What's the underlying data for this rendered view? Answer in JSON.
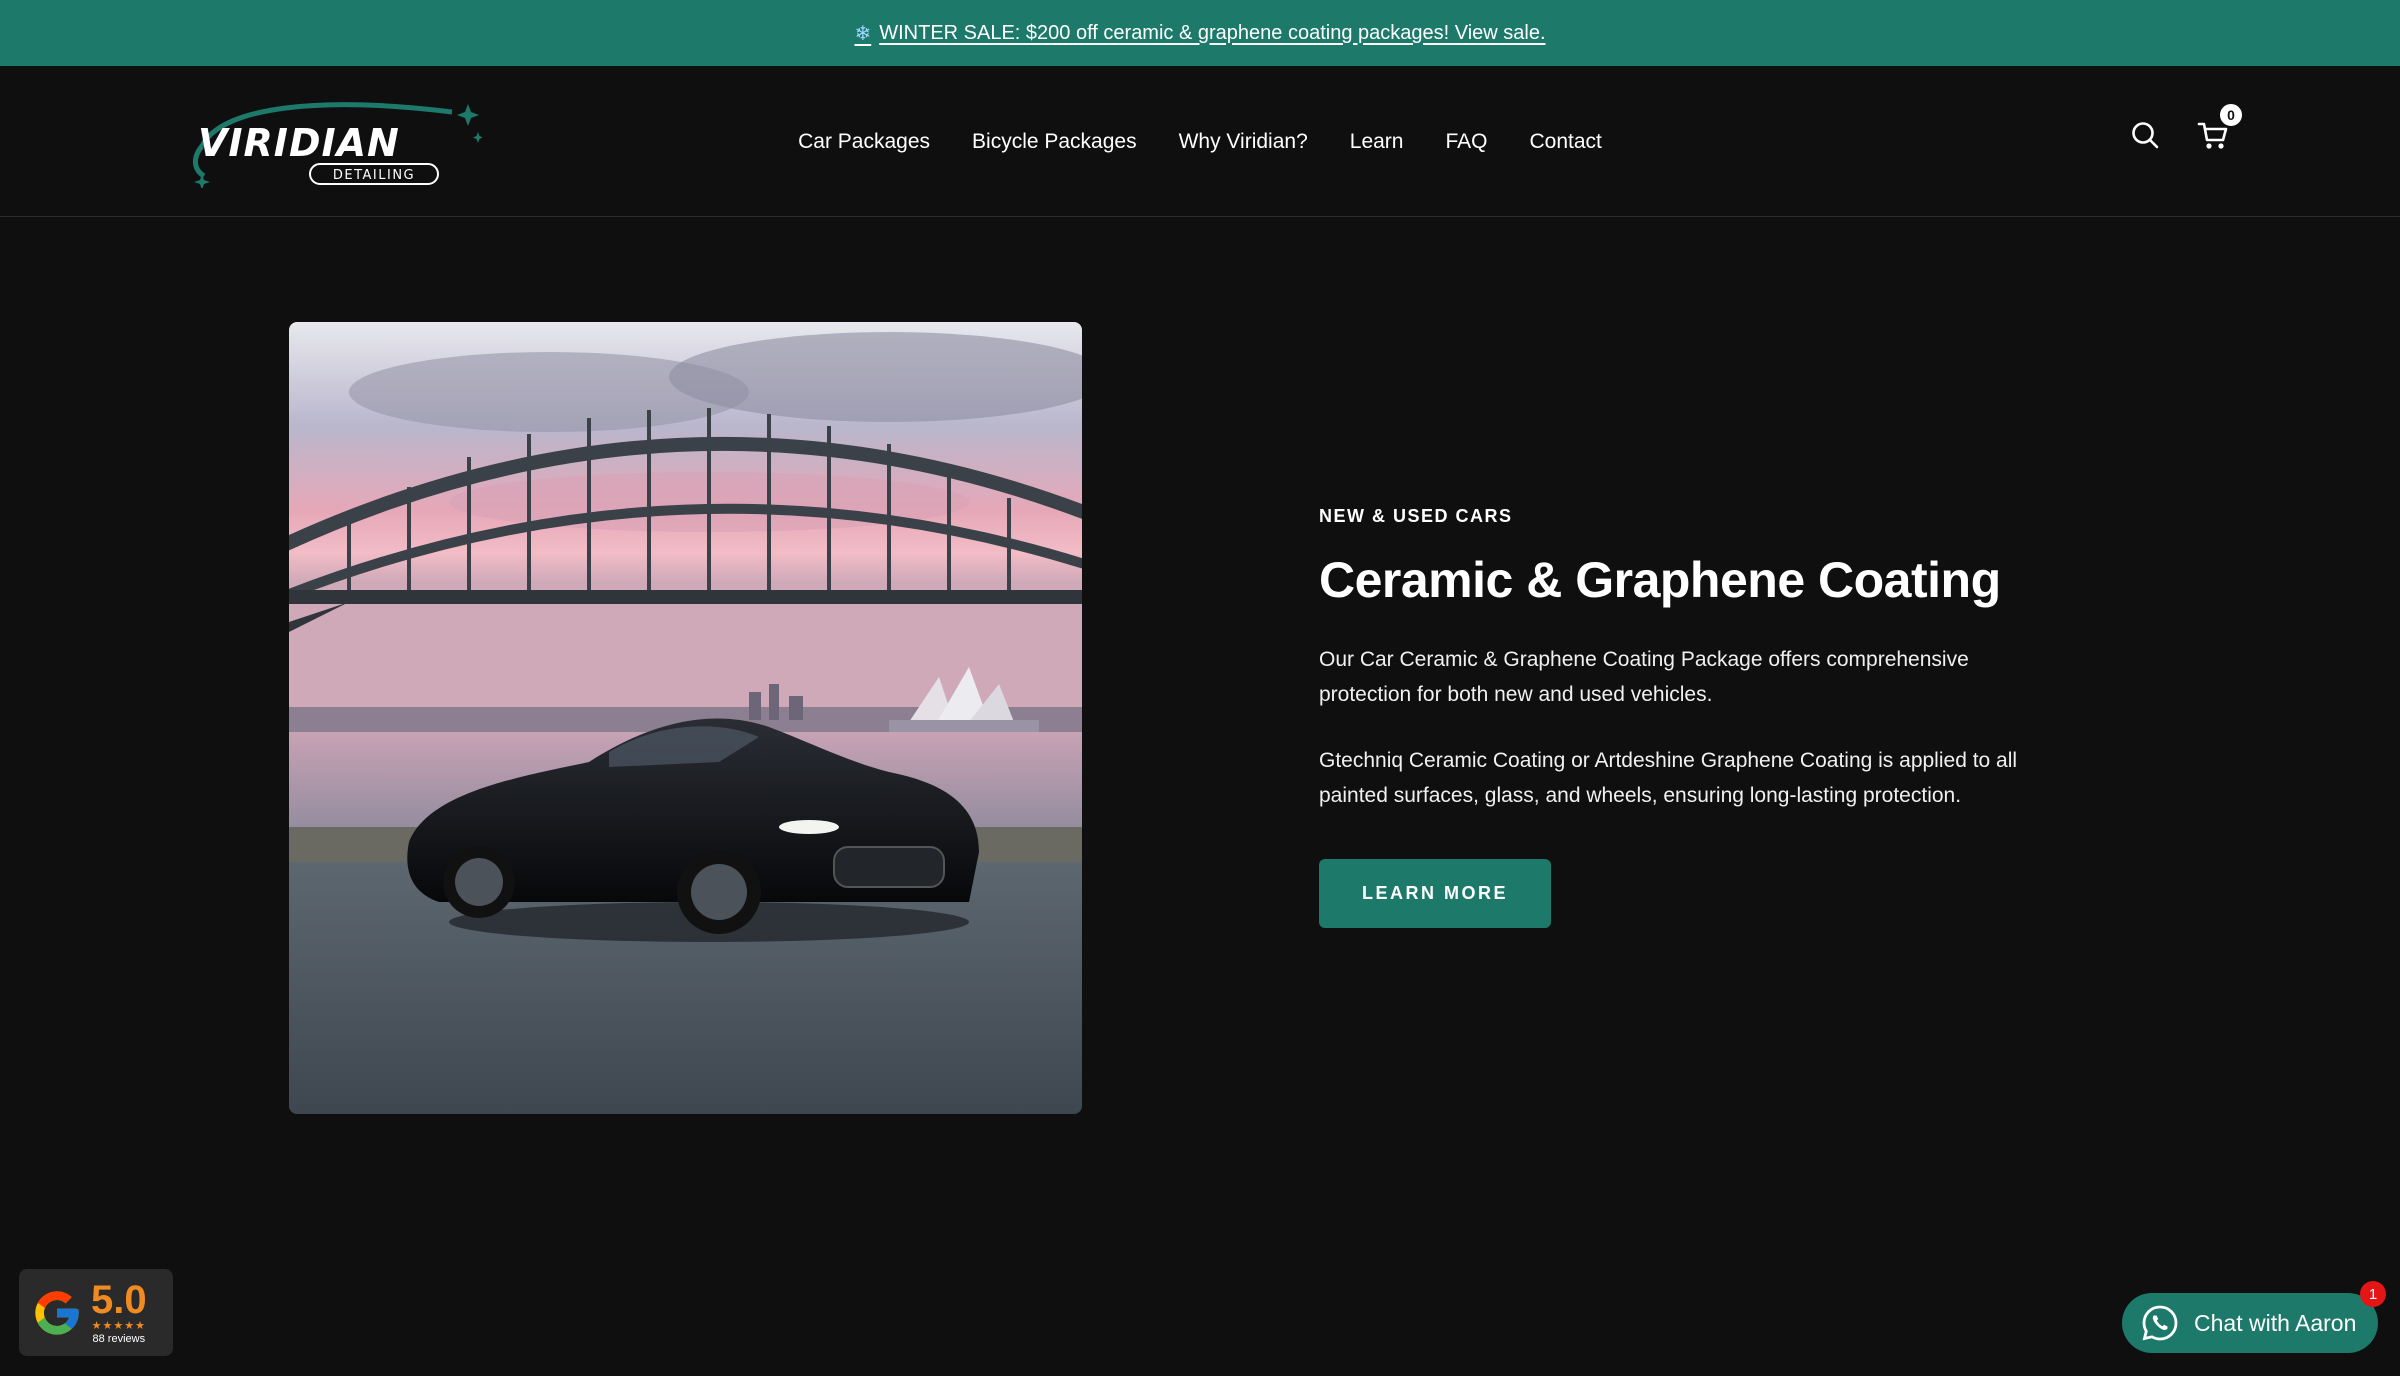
{
  "announcement": {
    "icon": "snowflake-icon",
    "text": "WINTER SALE: $200 off ceramic & graphene coating packages! View sale."
  },
  "header": {
    "logo_text": "VIRIDIAN",
    "logo_subtext": "DETAILING",
    "nav": [
      {
        "label": "Car Packages"
      },
      {
        "label": "Bicycle Packages"
      },
      {
        "label": "Why Viridian?"
      },
      {
        "label": "Learn"
      },
      {
        "label": "FAQ"
      },
      {
        "label": "Contact"
      }
    ],
    "cart_count": "0",
    "icons": [
      "search-icon",
      "cart-icon"
    ]
  },
  "hero": {
    "eyebrow": "NEW & USED CARS",
    "title": "Ceramic & Graphene Coating",
    "paragraphs": [
      "Our Car Ceramic & Graphene Coating Package offers comprehensive protection for both new and used vehicles.",
      "Gtechniq Ceramic Coating or Artdeshine Graphene Coating is applied to all painted surfaces, glass, and wheels, ensuring long-lasting protection."
    ],
    "cta_label": "LEARN MORE"
  },
  "google_badge": {
    "score": "5.0",
    "stars": "★★★★★",
    "reviews": "88 reviews"
  },
  "chat": {
    "label": "Chat with Aaron",
    "badge": "1"
  },
  "colors": {
    "brand_teal": "#1d7a6a",
    "background": "#0f0f0f",
    "rating_orange": "#f08a22",
    "notification_red": "#e31515"
  }
}
